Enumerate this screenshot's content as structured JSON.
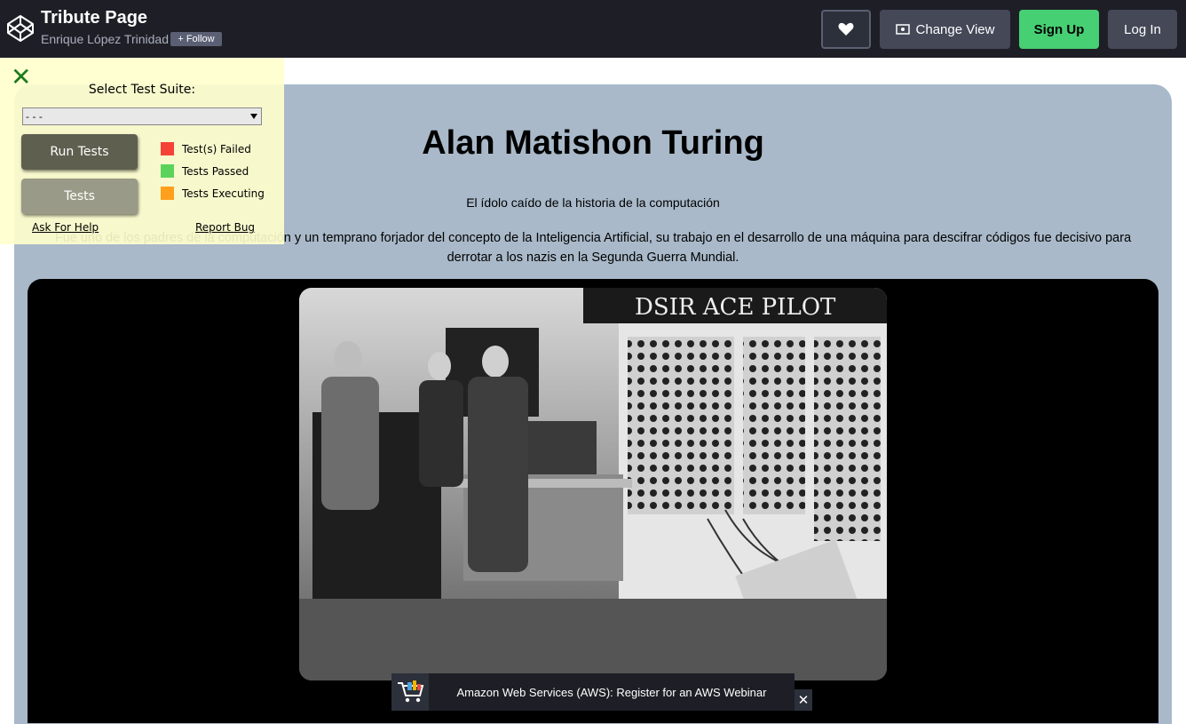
{
  "header": {
    "title": "Tribute Page",
    "author": "Enrique López Trinidad",
    "follow_label": "Follow",
    "change_view_label": "Change View",
    "signup_label": "Sign Up",
    "login_label": "Log In"
  },
  "tribute": {
    "title": "Alan Matishon Turing",
    "subtitle": "El ídolo caído de la historia de la computación",
    "description": "Fue uno de los padres de la computación y un temprano forjador del concepto de la Inteligencia Artificial, su trabajo en el desarrollo de una máquina para descifrar códigos fue decisivo para derrotar a los nazis en la Segunda Guerra Mundial.",
    "photo_text": "DSIR ACE PILOT"
  },
  "test_panel": {
    "suite_label": "Select Test Suite:",
    "suite_value": "- - -",
    "run_tests_label": "Run Tests",
    "tests_label": "Tests",
    "legend": [
      {
        "label": "Test(s) Failed",
        "color": "#f44336"
      },
      {
        "label": "Tests Passed",
        "color": "#5bd35b"
      },
      {
        "label": "Tests Executing",
        "color": "#ff9f1c"
      }
    ],
    "help_label": "Ask For Help",
    "bug_label": "Report Bug"
  },
  "ad": {
    "text": "Amazon Web Services (AWS): Register for an AWS Webinar"
  }
}
